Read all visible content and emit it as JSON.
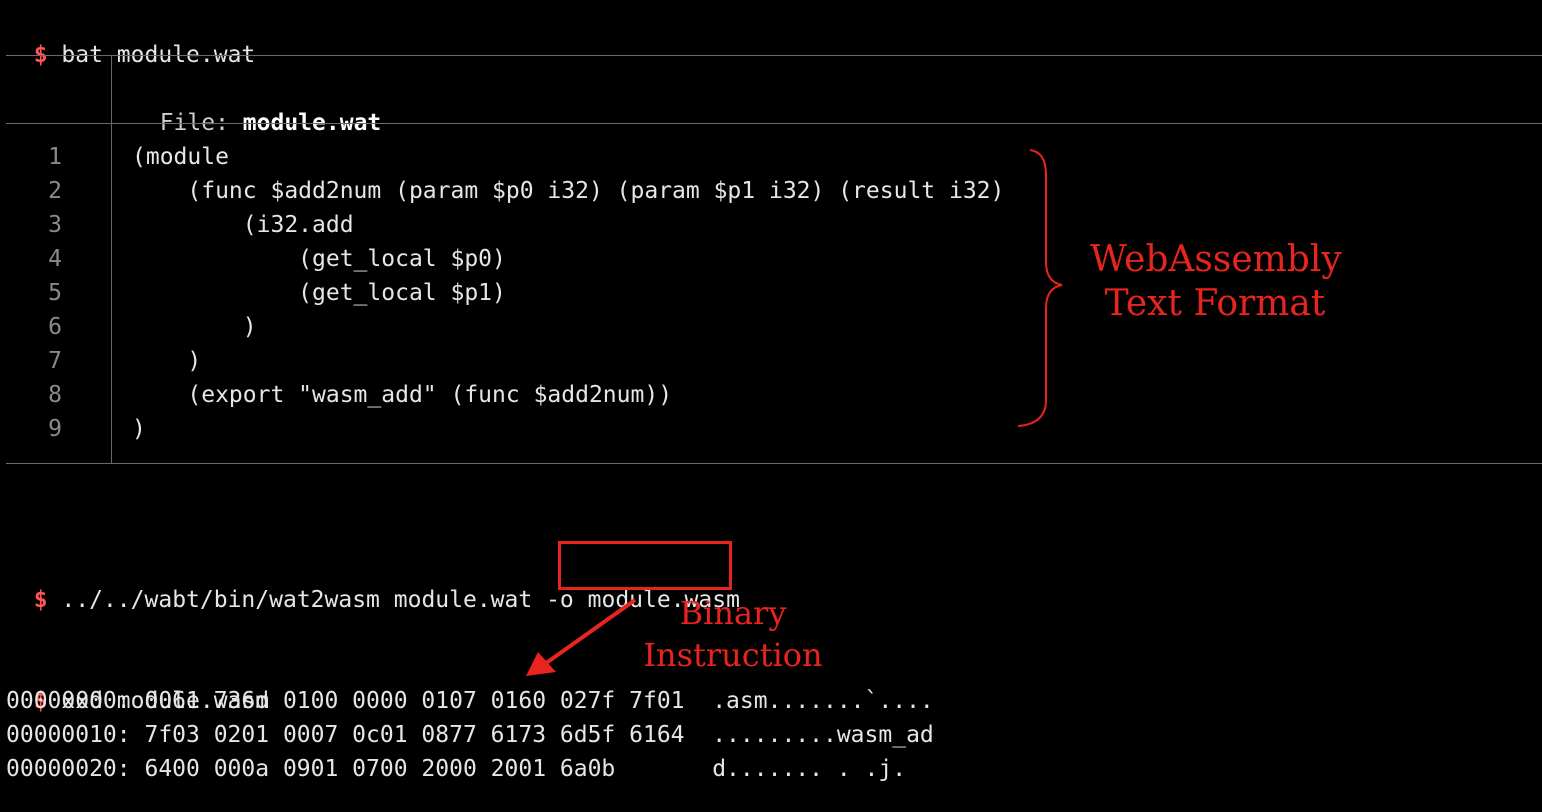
{
  "terminal": {
    "prompt_symbol": "$",
    "cmd_bat": "bat module.wat",
    "cmd_wat2wasm_prefix": "../../wabt/bin/wat2wasm module.wat -o ",
    "cmd_wat2wasm_output": "module.wasm",
    "cmd_xxd": "xxd module.wasm"
  },
  "bat": {
    "file_label": "File: ",
    "file_name": "module.wat",
    "line_numbers": [
      "1",
      "2",
      "3",
      "4",
      "5",
      "6",
      "7",
      "8",
      "9"
    ],
    "code_lines": [
      "(module",
      "    (func $add2num (param $p0 i32) (param $p1 i32) (result i32)",
      "        (i32.add",
      "            (get_local $p0)",
      "            (get_local $p1)",
      "        )",
      "    )",
      "    (export \"wasm_add\" (func $add2num))",
      ")"
    ]
  },
  "hexdump": {
    "rows": [
      "00000000: 0061 736d 0100 0000 0107 0160 027f 7f01  .asm.......`....",
      "00000010: 7f03 0201 0007 0c01 0877 6173 6d5f 6164  .........wasm_ad",
      "00000020: 6400 000a 0901 0700 2000 2001 6a0b       d....... . .j."
    ]
  },
  "annotations": {
    "wat_label_line1": "WebAssembly",
    "wat_label_line2": "Text Format",
    "binary_label_line1": "Binary",
    "binary_label_line2": "Instruction",
    "color": "#e8241f"
  }
}
